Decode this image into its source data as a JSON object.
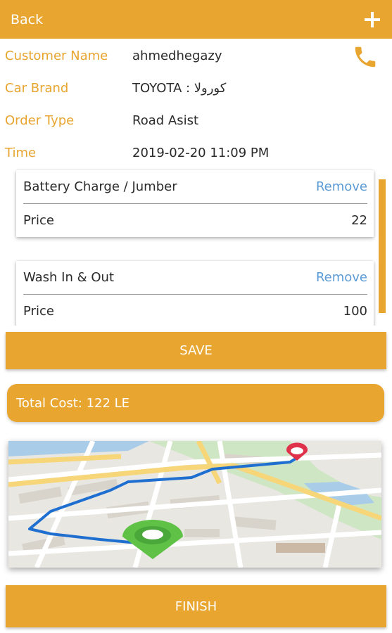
{
  "header": {
    "back_label": "Back",
    "add_icon": "plus-icon"
  },
  "order": {
    "customer_label": "Customer Name",
    "customer_value": "ahmedhegazy",
    "brand_label": "Car Brand",
    "brand_value": "TOYOTA : كورولا",
    "type_label": "Order Type",
    "type_value": "Road Asist",
    "time_label": "Time",
    "time_value": "2019-02-20 11:09 PM",
    "call_icon": "phone-icon"
  },
  "services": [
    {
      "name": "Battery Charge / Jumber",
      "remove_label": "Remove",
      "price_label": "Price",
      "price": "22"
    },
    {
      "name": "Wash In & Out",
      "remove_label": "Remove",
      "price_label": "Price",
      "price": "100"
    }
  ],
  "save_label": "SAVE",
  "total_label": "Total Cost: 122 LE",
  "finish_label": "FINISH",
  "colors": {
    "accent": "#e8a52f",
    "link": "#5b9bd5"
  }
}
